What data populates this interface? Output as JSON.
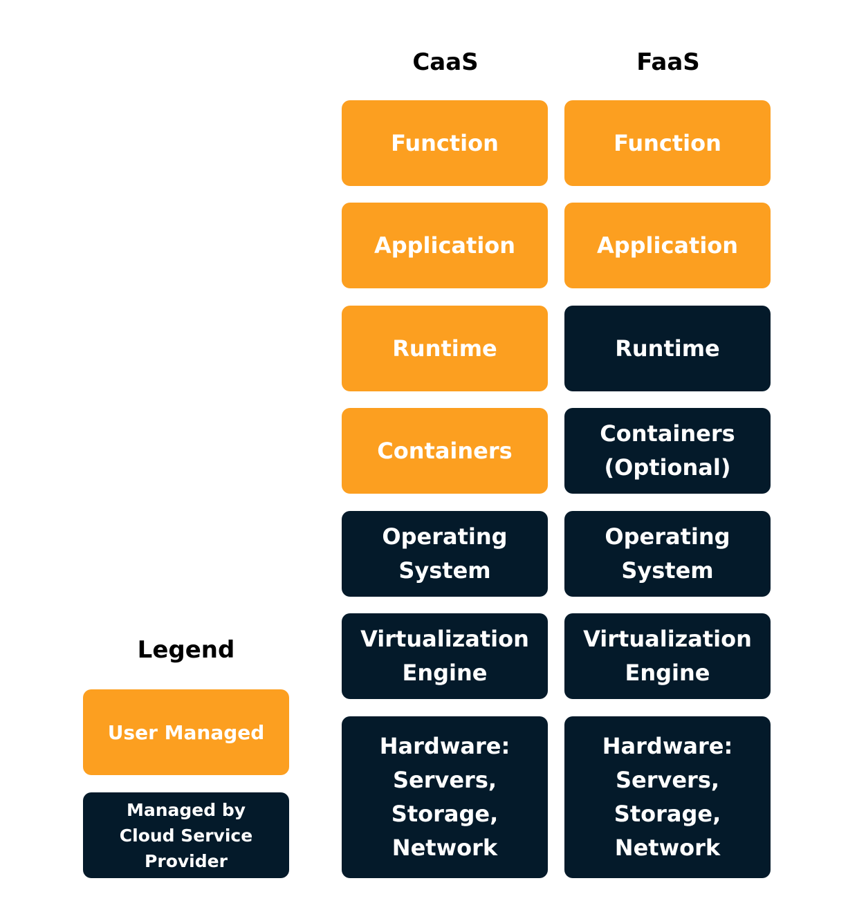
{
  "columns": [
    {
      "header": "CaaS",
      "layers": [
        {
          "label": "Function",
          "managed_by": "user"
        },
        {
          "label": "Application",
          "managed_by": "user"
        },
        {
          "label": "Runtime",
          "managed_by": "user"
        },
        {
          "label": "Containers",
          "managed_by": "user"
        },
        {
          "label": "Operating\nSystem",
          "managed_by": "provider"
        },
        {
          "label": "Virtualization\nEngine",
          "managed_by": "provider"
        },
        {
          "label": "Hardware:\nServers,\nStorage,\nNetwork",
          "managed_by": "provider"
        }
      ]
    },
    {
      "header": "FaaS",
      "layers": [
        {
          "label": "Function",
          "managed_by": "user"
        },
        {
          "label": "Application",
          "managed_by": "user"
        },
        {
          "label": "Runtime",
          "managed_by": "provider"
        },
        {
          "label": "Containers\n(Optional)",
          "managed_by": "provider"
        },
        {
          "label": "Operating\nSystem",
          "managed_by": "provider"
        },
        {
          "label": "Virtualization\nEngine",
          "managed_by": "provider"
        },
        {
          "label": "Hardware:\nServers,\nStorage,\nNetwork",
          "managed_by": "provider"
        }
      ]
    }
  ],
  "legend": {
    "title": "Legend",
    "user_label": "User Managed",
    "provider_label": "Managed by\nCloud Service\nProvider"
  },
  "colors": {
    "user": "#fc9f20",
    "provider": "#041a2a"
  }
}
